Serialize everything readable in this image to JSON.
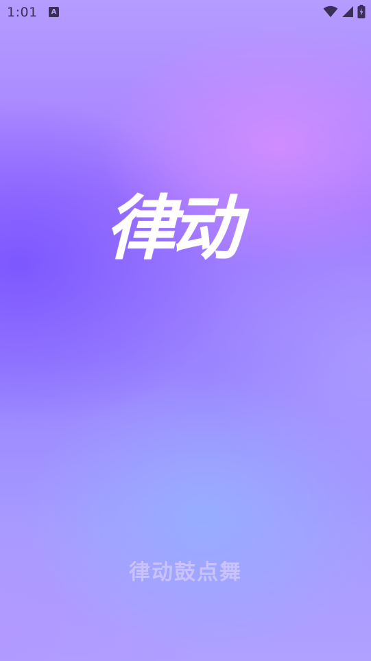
{
  "status_bar": {
    "time": "1:01",
    "notification_icon": "a-letter-icon",
    "notification_letter": "A",
    "icons": [
      "wifi-icon",
      "cellular-signal-icon",
      "battery-charging-icon"
    ]
  },
  "splash": {
    "logo_text": "律动",
    "caption": "律动鼓点舞"
  },
  "colors": {
    "logo": "#ffffff",
    "caption": "#d2c8ff",
    "status_text": "#3a2f56",
    "bg_top": "#b59cff",
    "bg_highlight": "#d68eff",
    "bg_deep": "#724aff",
    "bg_bottom_glow": "#96afff"
  }
}
